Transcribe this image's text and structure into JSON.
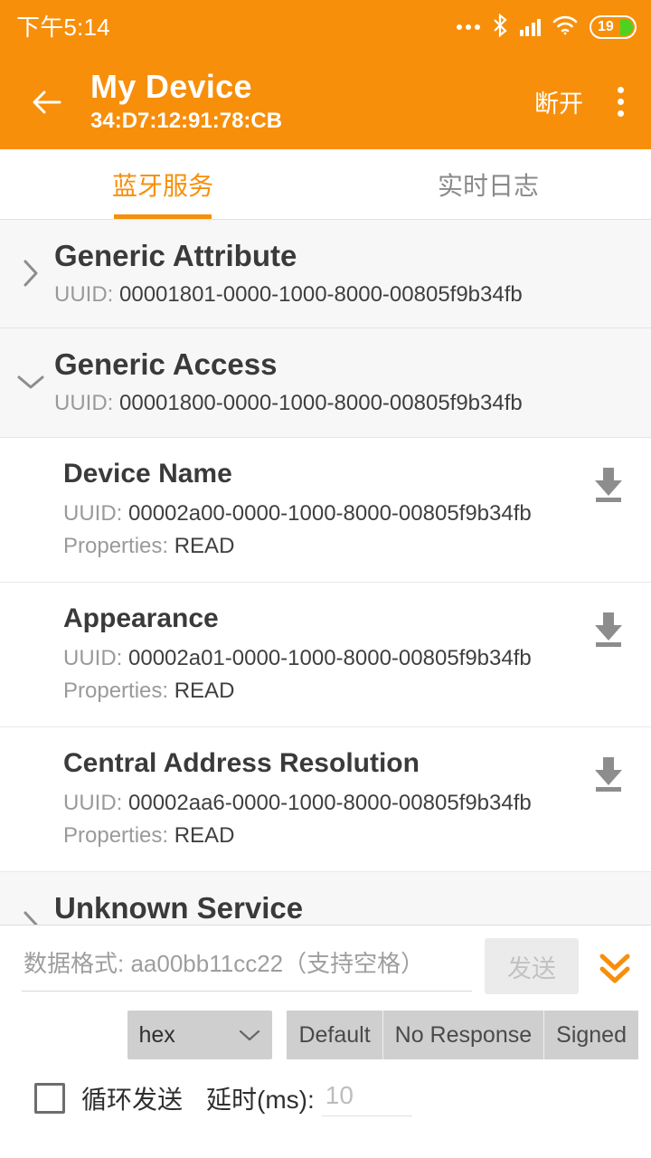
{
  "theme": {
    "accent": "#F78F0B",
    "battery_fill": "#4CD320"
  },
  "status_bar": {
    "time": "下午5:14",
    "icons": [
      "ellipsis-icon",
      "bluetooth-icon",
      "signal-icon",
      "wifi-icon",
      "battery-icon"
    ],
    "battery_level": "19"
  },
  "app_bar": {
    "back_icon": "back-arrow-icon",
    "title": "My Device",
    "subtitle": "34:D7:12:91:78:CB",
    "action_label": "断开",
    "overflow_icon": "more-vertical-icon"
  },
  "tabs": [
    {
      "label": "蓝牙服务",
      "active": true
    },
    {
      "label": "实时日志",
      "active": false
    }
  ],
  "uuid_prefix": "UUID: ",
  "props_prefix": "Properties: ",
  "services": [
    {
      "name": "Generic Attribute",
      "uuid": "00001801-0000-1000-8000-00805f9b34fb",
      "expanded": false,
      "chevron": "chevron-right-icon",
      "characteristics": []
    },
    {
      "name": "Generic Access",
      "uuid": "00001800-0000-1000-8000-00805f9b34fb",
      "expanded": true,
      "chevron": "chevron-down-icon",
      "characteristics": [
        {
          "name": "Device Name",
          "uuid": "00002a00-0000-1000-8000-00805f9b34fb",
          "properties": "READ",
          "action_icon": "download-icon"
        },
        {
          "name": "Appearance",
          "uuid": "00002a01-0000-1000-8000-00805f9b34fb",
          "properties": "READ",
          "action_icon": "download-icon"
        },
        {
          "name": "Central Address Resolution",
          "uuid": "00002aa6-0000-1000-8000-00805f9b34fb",
          "properties": "READ",
          "action_icon": "download-icon"
        }
      ]
    },
    {
      "name": "Unknown Service",
      "uuid": "",
      "expanded": false,
      "chevron": "chevron-right-icon",
      "characteristics": []
    }
  ],
  "write_panel": {
    "data_input": {
      "value": "",
      "placeholder": "数据格式: aa00bb11cc22（支持空格）"
    },
    "send_label": "发送",
    "expand_icon": "double-chevron-down-icon",
    "format_select": {
      "value": "hex",
      "chevron": "chevron-down-icon"
    },
    "write_modes": [
      "Default",
      "No Response",
      "Signed"
    ],
    "loop_checkbox": {
      "label": "循环发送",
      "checked": false
    },
    "delay_label": "延时(ms):",
    "delay_input": {
      "value": "",
      "placeholder": "10"
    }
  }
}
